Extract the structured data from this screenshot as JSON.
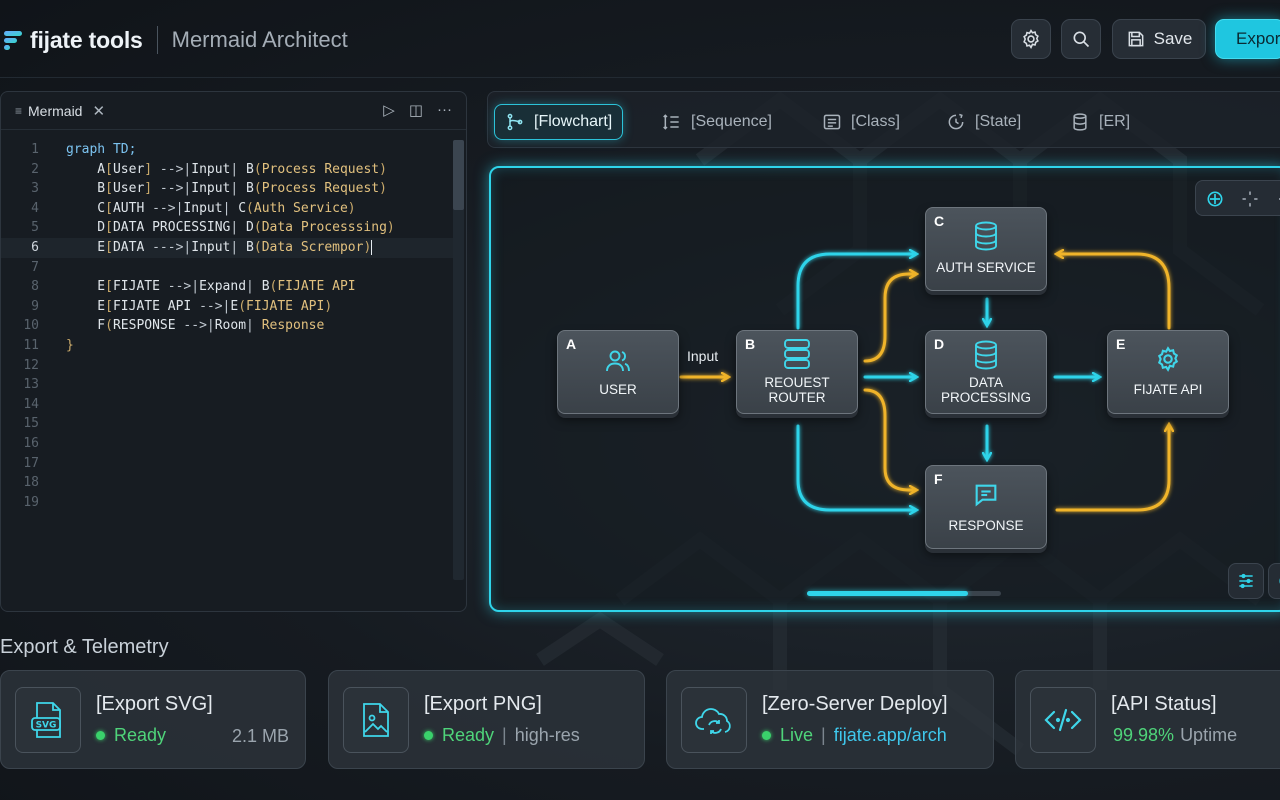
{
  "header": {
    "brand": "fijate tools",
    "app_title": "Mermaid Architect",
    "save_label": "Save",
    "export_label": "Export"
  },
  "editor": {
    "tab_label": "Mermaid",
    "lines": [
      {
        "n": "1",
        "parts": [
          [
            "k",
            "graph TD;"
          ]
        ]
      },
      {
        "n": "2",
        "parts": [
          [
            "n",
            "    A"
          ],
          [
            "b",
            "["
          ],
          [
            "n",
            "User"
          ],
          [
            "b",
            "]"
          ],
          [
            "o",
            " -->|"
          ],
          [
            "n",
            "Input"
          ],
          [
            "o",
            "| "
          ],
          [
            "n",
            "B"
          ],
          [
            "b",
            "("
          ],
          [
            "s",
            "Process Request"
          ],
          [
            "b",
            ")"
          ]
        ]
      },
      {
        "n": "3",
        "parts": [
          [
            "n",
            "    B"
          ],
          [
            "b",
            "["
          ],
          [
            "n",
            "User"
          ],
          [
            "b",
            "]"
          ],
          [
            "o",
            " -->|"
          ],
          [
            "n",
            "Input"
          ],
          [
            "o",
            "| "
          ],
          [
            "n",
            "B"
          ],
          [
            "b",
            "("
          ],
          [
            "s",
            "Process Request"
          ],
          [
            "b",
            ")"
          ]
        ]
      },
      {
        "n": "4",
        "parts": [
          [
            "n",
            "    C"
          ],
          [
            "b",
            "["
          ],
          [
            "n",
            "AUTH"
          ],
          [
            "o",
            " -->|"
          ],
          [
            "n",
            "Input"
          ],
          [
            "o",
            "| "
          ],
          [
            "n",
            "C"
          ],
          [
            "b",
            "("
          ],
          [
            "s",
            "Auth Service"
          ],
          [
            "b",
            ")"
          ]
        ]
      },
      {
        "n": "5",
        "parts": [
          [
            "n",
            "    D"
          ],
          [
            "b",
            "["
          ],
          [
            "n",
            "DATA PROCESSING"
          ],
          [
            "o",
            "| "
          ],
          [
            "n",
            "D"
          ],
          [
            "b",
            "("
          ],
          [
            "s",
            "Data Processsing"
          ],
          [
            "b",
            ")"
          ]
        ]
      },
      {
        "n": "6",
        "parts": [
          [
            "n",
            "    E"
          ],
          [
            "b",
            "["
          ],
          [
            "n",
            "DATA"
          ],
          [
            "o",
            " --->|"
          ],
          [
            "n",
            "Input"
          ],
          [
            "o",
            "| "
          ],
          [
            "n",
            "B"
          ],
          [
            "b",
            "("
          ],
          [
            "s",
            "Data Scrempor"
          ],
          [
            "b",
            ")"
          ]
        ],
        "active": true
      },
      {
        "n": "7",
        "parts": []
      },
      {
        "n": "8",
        "parts": [
          [
            "n",
            "    E"
          ],
          [
            "b",
            "["
          ],
          [
            "n",
            "FIJATE"
          ],
          [
            "o",
            " -->|"
          ],
          [
            "n",
            "Expand"
          ],
          [
            "o",
            "| "
          ],
          [
            "n",
            "B"
          ],
          [
            "b",
            "("
          ],
          [
            "s",
            "FIJATE API"
          ]
        ]
      },
      {
        "n": "9",
        "parts": [
          [
            "n",
            "    E"
          ],
          [
            "b",
            "["
          ],
          [
            "n",
            "FIJATE API"
          ],
          [
            "o",
            " -->|"
          ],
          [
            "n",
            "E"
          ],
          [
            "b",
            "("
          ],
          [
            "s",
            "FIJATE API"
          ],
          [
            "b",
            ")"
          ]
        ]
      },
      {
        "n": "10",
        "parts": [
          [
            "n",
            "    F"
          ],
          [
            "b",
            "("
          ],
          [
            "n",
            "RESPONSE"
          ],
          [
            "o",
            " -->|"
          ],
          [
            "n",
            "Room"
          ],
          [
            "o",
            "| "
          ],
          [
            "s",
            "Response"
          ]
        ]
      },
      {
        "n": "11",
        "parts": [
          [
            "b",
            "}"
          ]
        ]
      },
      {
        "n": "12",
        "parts": []
      },
      {
        "n": "13",
        "parts": []
      },
      {
        "n": "14",
        "parts": []
      },
      {
        "n": "15",
        "parts": []
      },
      {
        "n": "16",
        "parts": []
      },
      {
        "n": "17",
        "parts": []
      },
      {
        "n": "18",
        "parts": []
      },
      {
        "n": "19",
        "parts": []
      }
    ]
  },
  "diagram_tabs": [
    {
      "label": "[Flowchart]",
      "icon": "git-branch-icon",
      "active": true
    },
    {
      "label": "[Sequence]",
      "icon": "sequence-list-icon",
      "active": false
    },
    {
      "label": "[Class]",
      "icon": "class-table-icon",
      "active": false
    },
    {
      "label": "[State]",
      "icon": "state-clock-icon",
      "active": false
    },
    {
      "label": "[ER]",
      "icon": "database-icon",
      "active": false
    }
  ],
  "diagram": {
    "nodes": [
      {
        "id": "A",
        "label_lines": [
          "USER"
        ],
        "icon": "users-icon"
      },
      {
        "id": "B",
        "label_lines": [
          "REOUEST",
          "ROUTER"
        ],
        "icon": "server-icon"
      },
      {
        "id": "C",
        "label_lines": [
          "AUTH SERVICE"
        ],
        "icon": "database-icon"
      },
      {
        "id": "D",
        "label_lines": [
          "DATA",
          "PROCESSING"
        ],
        "icon": "database-icon"
      },
      {
        "id": "E",
        "label_lines": [
          "FIJATE API"
        ],
        "icon": "gear-icon"
      },
      {
        "id": "F",
        "label_lines": [
          "RESPONSE"
        ],
        "icon": "chat-icon"
      }
    ],
    "edge_label_input": "Input",
    "scroll_progress": 0.83,
    "colors": {
      "cyan": "#2fd4ea",
      "amber": "#f0b429"
    }
  },
  "telemetry": {
    "title": "Export & Telemetry",
    "cards": [
      {
        "title": "[Export SVG]",
        "status": "Ready",
        "detail": "2.1 MB",
        "icon": "svg-file-icon"
      },
      {
        "title": "[Export PNG]",
        "status": "Ready",
        "detail": "high-res",
        "icon": "image-icon"
      },
      {
        "title": "[Zero-Server Deploy]",
        "status": "Live",
        "detail": "fijate.app/arch",
        "icon": "cloud-sync-icon"
      },
      {
        "title": "[API Status]",
        "status": "99.98%",
        "detail": "Uptime",
        "icon": "code-icon"
      }
    ]
  }
}
